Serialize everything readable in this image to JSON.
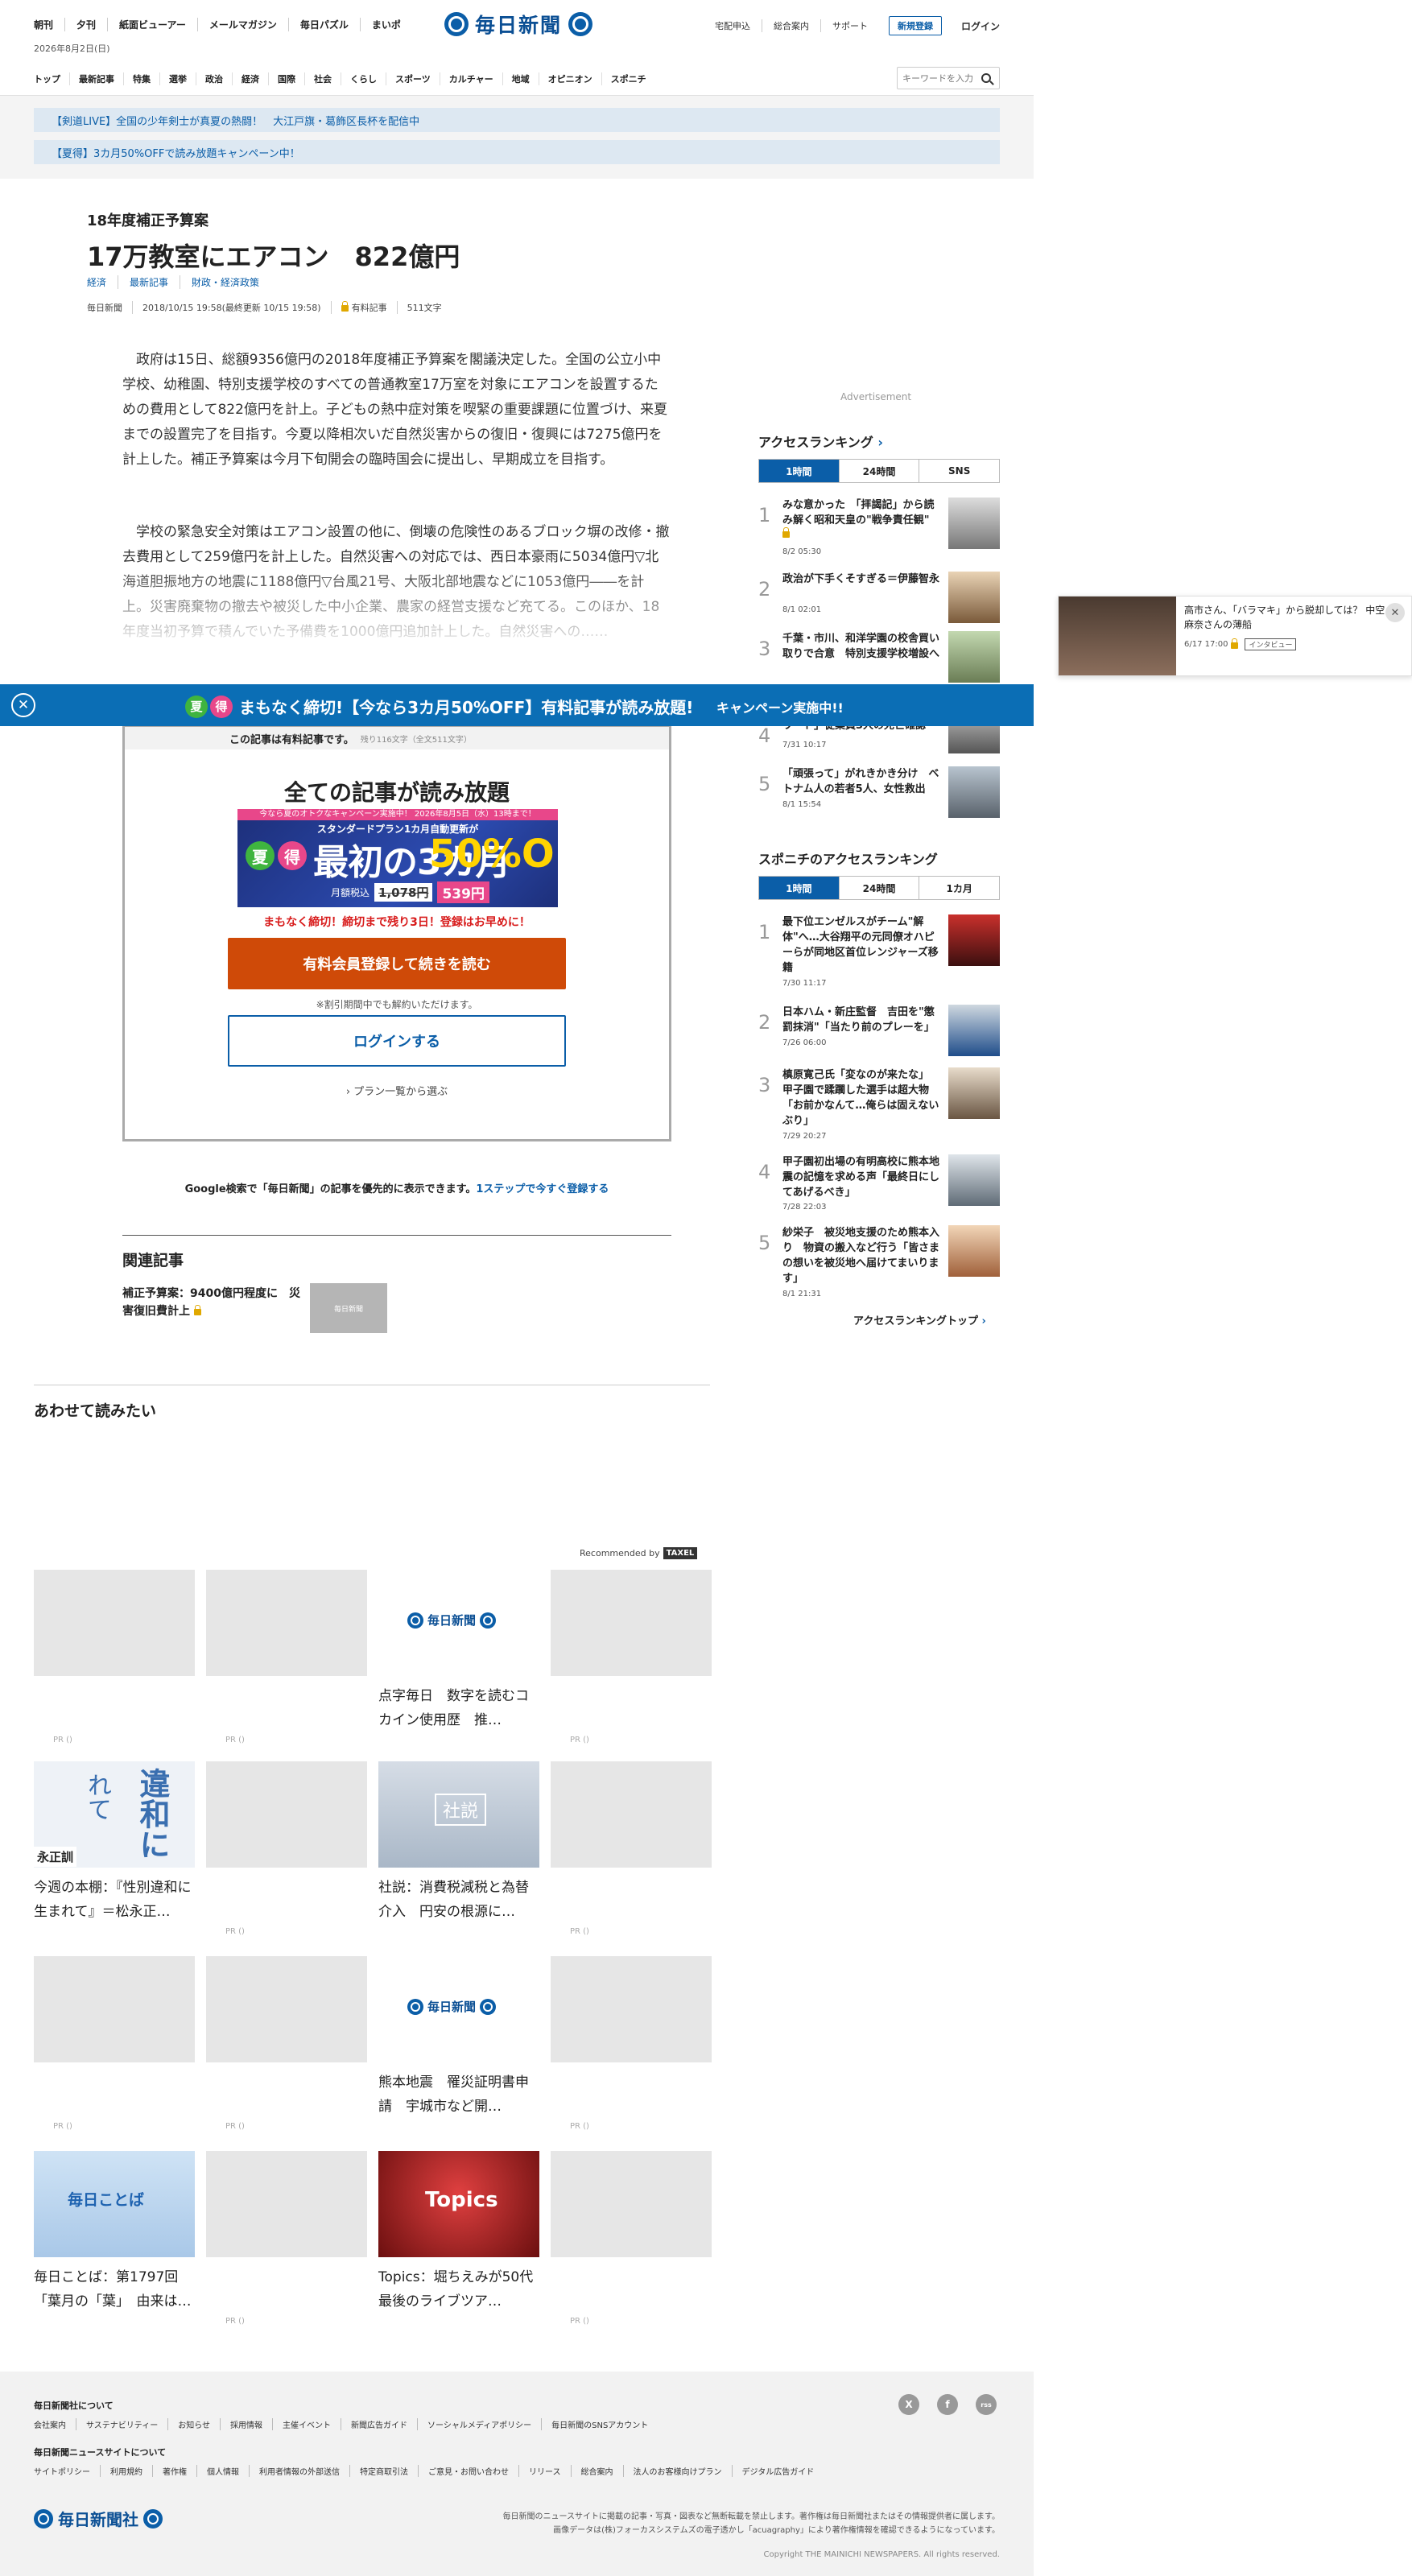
{
  "header": {
    "top_nav": [
      "朝刊",
      "夕刊",
      "紙面ビューアー",
      "メールマガジン",
      "毎日パズル",
      "まいポ"
    ],
    "date": "2026年8月2日(日)",
    "logo": "毎日新聞",
    "right_nav": [
      "宅配申込",
      "総合案内",
      "サポート"
    ],
    "register": "新規登録",
    "login": "ログイン",
    "categories": [
      "トップ",
      "最新記事",
      "特集",
      "選挙",
      "政治",
      "経済",
      "国際",
      "社会",
      "くらし",
      "スポーツ",
      "カルチャー",
      "地域",
      "オピニオン",
      "スポニチ"
    ],
    "search_placeholder": "キーワードを入力"
  },
  "notices": [
    "【剣道LIVE】全国の少年剣士が真夏の熱闘！　大江戸旗・葛飾区長杯を配信中",
    "【夏得】3カ月50%OFFで読み放題キャンペーン中！"
  ],
  "article": {
    "kicker": "18年度補正予算案",
    "title": "17万教室にエアコン　822億円",
    "tags": [
      "経済",
      "最新記事",
      "財政・経済政策"
    ],
    "meta": [
      "毎日新聞",
      "2018/10/15 19:58(最終更新 10/15 19:58)",
      "有料記事",
      "511文字"
    ],
    "paragraphs": [
      "政府は15日、総額9356億円の2018年度補正予算案を閣議決定した。全国の公立小中学校、幼稚園、特別支援学校のすべての普通教室17万室を対象にエアコンを設置するための費用として822億円を計上。子どもの熱中症対策を喫緊の重要課題に位置づけ、来夏までの設置完了を目指す。今夏以降相次いだ自然災害からの復旧・復興には7275億円を計上した。補正予算案は今月下旬開会の臨時国会に提出し、早期成立を目指す。",
      "学校の緊急安全対策はエアコン設置の他に、倒壊の危険性のあるブロック塀の改修・撤去費用として259億円を計上した。自然災害への対応では、西日本豪雨に5034億円▽北海道胆振地方の地震に1188億円▽台風21号、大阪北部地震などに1053億円――を計上。災害廃棄物の撤去や被災した中小企業、農家の経営支援など充てる。このほか、18年度当初予算で積んでいた予備費を1000億円追加計上した。自然災害への……"
    ]
  },
  "banner": {
    "badge1": "夏",
    "badge2": "得",
    "text": "まもなく締切!【今なら3カ月50%OFF】有料記事が読み放題!",
    "cta": "キャンペーン実施中!!"
  },
  "paywall": {
    "head": "この記事は有料記事です。",
    "head_note": "残り116文字（全文511文字）",
    "title": "全ての記事が読み放題",
    "promo_top": "今なら夏のオトクなキャンペーン実施中！ 2026年8月5日（水）13時まで！",
    "promo_sub": "スタンダードプラン1カ月自動更新が",
    "promo_natsu": "夏",
    "promo_toku": "得",
    "promo_main": "最初の3カ月",
    "promo_off": "50%OFF!",
    "price_label": "月額税込",
    "price_old": "1,078円",
    "price_new": "539円",
    "urgent": "まもなく締切！締切まで残り3日！登録はお早めに！",
    "register_button": "有料会員登録して続きを読む",
    "note": "※割引期間中でも解約いただけます。",
    "login_button": "ログインする",
    "plans": "プラン一覧から選ぶ"
  },
  "google_line": {
    "text": "Google検索で「毎日新聞」の記事を優先的に表示できます。",
    "link": "1ステップで今すぐ登録する"
  },
  "related": {
    "heading": "関連記事",
    "item": "補正予算案：9400億円程度に　災害復旧費計上",
    "thumb_label": "毎日新聞"
  },
  "also_read": {
    "heading": "あわせて読みたい",
    "recommended_by": "Recommended by",
    "recommender": "TAXEL",
    "cards": [
      {
        "caption": "",
        "pr": "PR ()"
      },
      {
        "caption": "",
        "pr": "PR ()"
      },
      {
        "caption": "点字毎日　数字を読むコカイン使用歴　推…",
        "logo": "毎日新聞"
      },
      {
        "caption": "",
        "pr": "PR ()"
      },
      {
        "caption": "今週の本棚：『性別違和に生まれて』＝松永正…",
        "thumb_text": "違和に",
        "thumb_text2": "れて",
        "thumb_author": "永正訓"
      },
      {
        "caption": "",
        "pr": "PR ()"
      },
      {
        "caption": "社説：消費税減税と為替介入　円安の根源に…",
        "thumb_text": "社説"
      },
      {
        "caption": "",
        "pr": "PR ()"
      },
      {
        "caption": "",
        "pr": "PR ()"
      },
      {
        "caption": "",
        "pr": "PR ()"
      },
      {
        "caption": "熊本地震　罹災証明書申請　宇城市など開…",
        "logo": "毎日新聞"
      },
      {
        "caption": "",
        "pr": "PR ()"
      },
      {
        "caption": "毎日ことば：第1797回　「葉月の「葉」　由来は…",
        "thumb_text": "毎日ことば"
      },
      {
        "caption": "",
        "pr": "PR ()"
      },
      {
        "caption": "Topics：堀ちえみが50代最後のライブツア…",
        "thumb_text": "Topics"
      },
      {
        "caption": "",
        "pr": "PR ()"
      }
    ]
  },
  "sidebar": {
    "ad": "Advertisement",
    "ranking_heading": "アクセスランキング",
    "ranking_tabs": [
      "1時間",
      "24時間",
      "SNS"
    ],
    "ranking": [
      {
        "title": "みな意かった　「拝謁記」から読み解く昭和天皇の\"戦争責任観\"",
        "time": "8/2 05:30",
        "lock": true
      },
      {
        "title": "政治が下手くそすぎる＝伊藤智永",
        "time": "8/1 02:01",
        "lock": true
      },
      {
        "title": "千葉・市川、和洋学園の校舎買い取りで合意　特別支援学校増設へ",
        "time": ""
      },
      {
        "title": "ワード」従業員3人の死亡確認",
        "time": "7/31 10:17"
      },
      {
        "title": "「頑張って」がれきかき分け　ベトナム人の若者5人、女性救出",
        "time": "8/1 15:54"
      }
    ],
    "sponichi_heading": "スポニチのアクセスランキング",
    "sponichi_tabs": [
      "1時間",
      "24時間",
      "1カ月"
    ],
    "sponichi": [
      {
        "title": "最下位エンゼルスがチーム\"解体\"へ…大谷翔平の元同僚オハピーらが同地区首位レンジャーズ移籍",
        "time": "7/30 11:17"
      },
      {
        "title": "日本ハム・新庄監督　吉田を\"懲罰抹消\"「当たり前のプレーを」",
        "time": "7/26 06:00"
      },
      {
        "title": "槙原寛己氏「変なのが来たな」　甲子園で蹂躙した選手は超大物「お前かなんて…俺らは固えないぶり」",
        "time": "7/29 20:27"
      },
      {
        "title": "甲子園初出場の有明高校に熊本地震の記憶を求める声「最終日にしてあげるべき」",
        "time": "7/28 22:03"
      },
      {
        "title": "紗栄子　被災地支援のため熊本入り　物資の搬入など行う「皆さまの想いを被災地へ届けてまいります」",
        "time": "8/1 21:31"
      }
    ],
    "more": "アクセスランキングトップ"
  },
  "popup": {
    "title": "高市さん、「バラマキ」から脱却しては？ 中空麻奈さんの薄船",
    "time": "6/17 17:00",
    "tag": "インタビュー"
  },
  "footer": {
    "company_heading": "毎日新聞社について",
    "company_links": [
      "会社案内",
      "サステナビリティー",
      "お知らせ",
      "採用情報",
      "主催イベント",
      "新聞広告ガイド",
      "ソーシャルメディアポリシー",
      "毎日新聞のSNSアカウント"
    ],
    "site_heading": "毎日新聞ニュースサイトについて",
    "site_links": [
      "サイトポリシー",
      "利用規約",
      "著作権",
      "個人情報",
      "利用者情報の外部送信",
      "特定商取引法",
      "ご意見・お問い合わせ",
      "リリース",
      "総合案内",
      "法人のお客様向けプラン",
      "デジタル広告ガイド"
    ],
    "sns": [
      "X",
      "f",
      "rss"
    ],
    "logo": "毎日新聞社",
    "note1": "毎日新聞のニュースサイトに掲載の記事・写真・図表など無断転載を禁止します。著作権は毎日新聞社またはその情報提供者に属します。",
    "note2": "画像データは(株)フォーカスシステムズの電子透かし「acuagraphy」により著作権情報を確認できるようになっています。",
    "copyright": "Copyright THE MAINICHI NEWSPAPERS. All rights reserved."
  },
  "colors": {
    "brand": "#0b5ea8",
    "cta": "#cf4a08",
    "urgent": "#d81b1b"
  }
}
